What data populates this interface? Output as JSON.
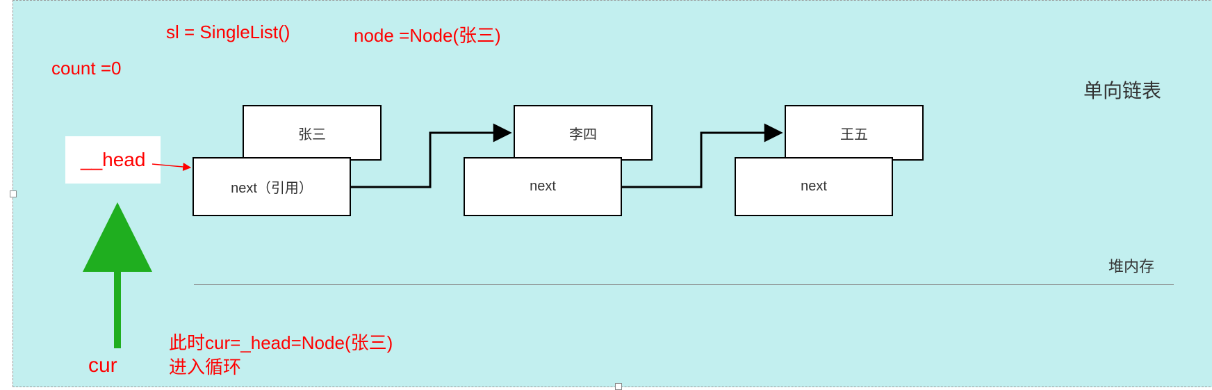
{
  "topline": {
    "sl": "sl = SingleList()",
    "node": "node =Node(张三)"
  },
  "count": "count =0",
  "head_label": "__head",
  "cur_label": "cur",
  "title": "单向链表",
  "heap_label": "堆内存",
  "nodes": [
    {
      "name": "张三",
      "next_label": "next（引用）"
    },
    {
      "name": "李四",
      "next_label": "next"
    },
    {
      "name": "王五",
      "next_label": "next"
    }
  ],
  "notes": {
    "line1": "此时cur=_head=Node(张三)",
    "line2": "进入循环"
  }
}
